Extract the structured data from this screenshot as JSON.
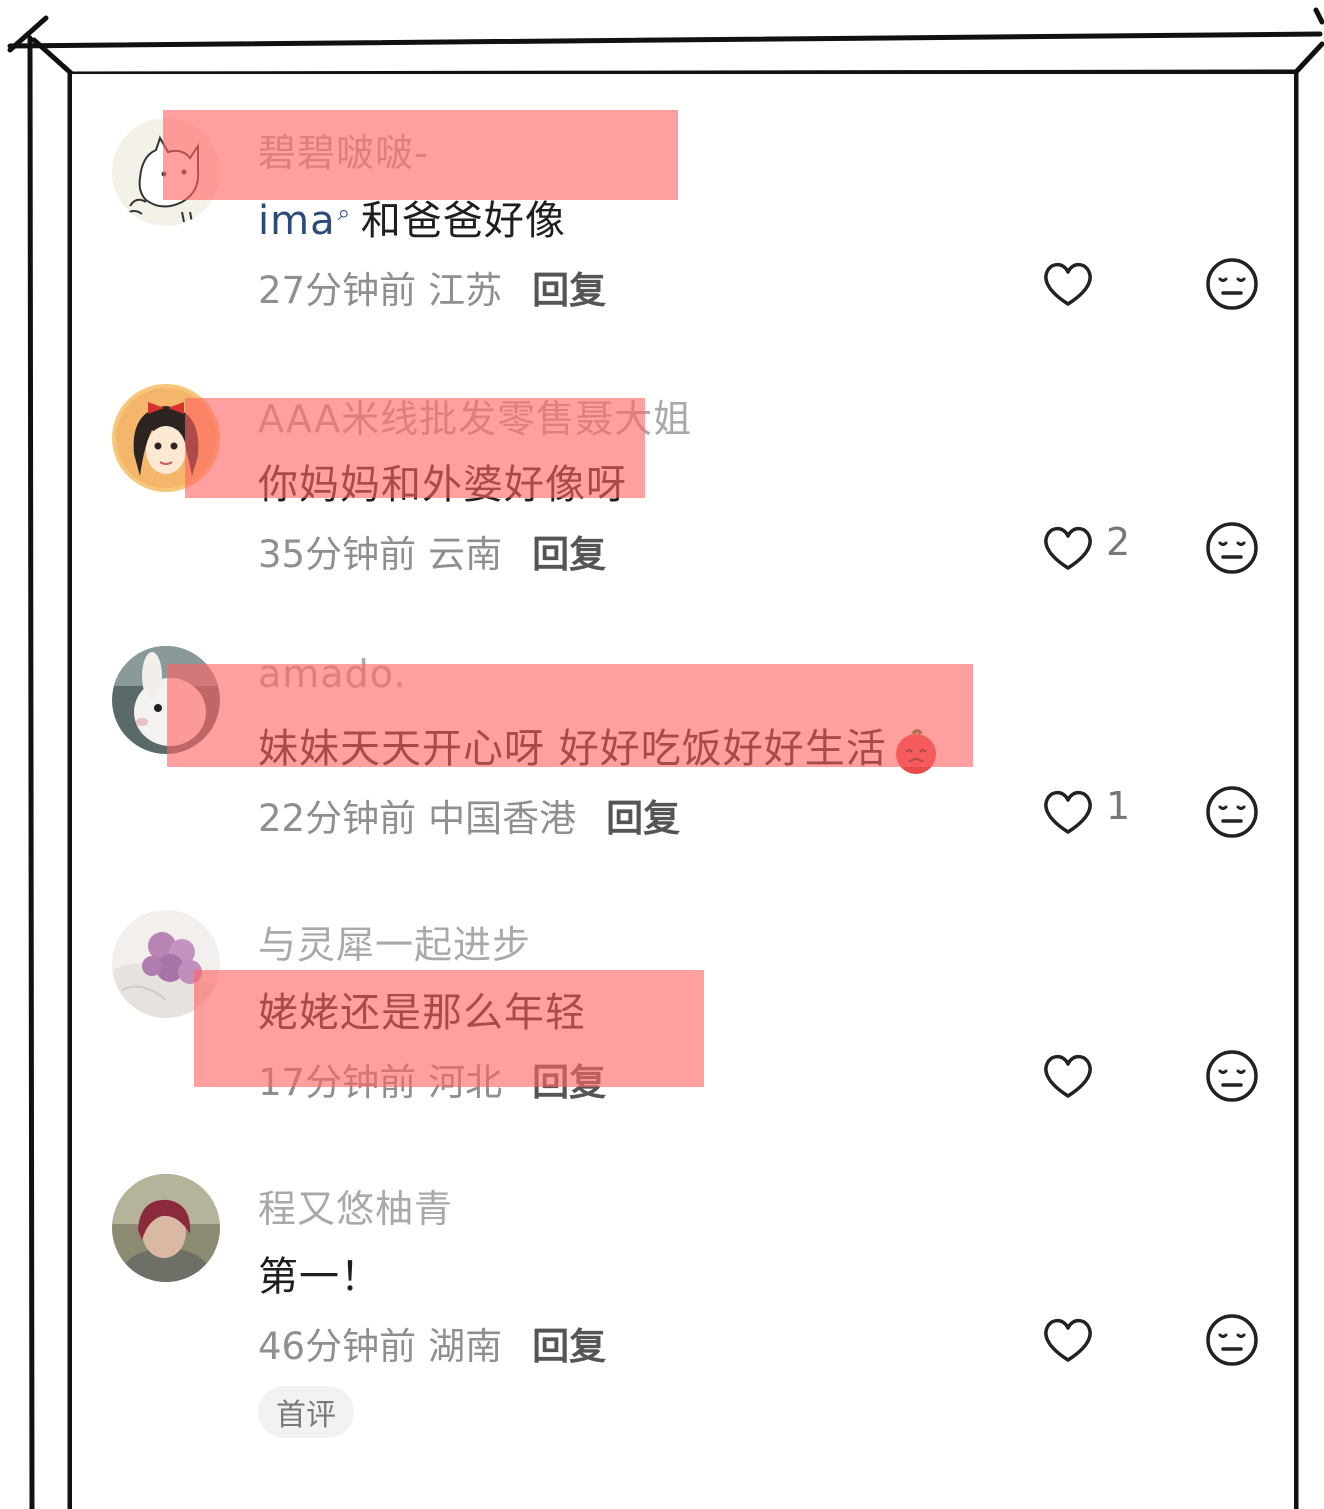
{
  "comments": [
    {
      "username": "碧碧啵啵-",
      "mention": "ima",
      "text": "和爸爸好像",
      "time": "27分钟前",
      "location": "江苏",
      "reply_label": "回复",
      "likes": "",
      "avatar": "cat-doodle-avatar"
    },
    {
      "username": "AAA米线批发零售聂大姐",
      "mention": "",
      "text": "你妈妈和外婆好像呀",
      "time": "35分钟前",
      "location": "云南",
      "reply_label": "回复",
      "likes": "2",
      "avatar": "anime-girl-avatar"
    },
    {
      "username": "amado.",
      "mention": "",
      "text": "妹妹天天开心呀 好好吃饭好好生活",
      "time": "22分钟前",
      "location": "中国香港",
      "reply_label": "回复",
      "likes": "1",
      "avatar": "rabbit-avatar"
    },
    {
      "username": "与灵犀一起进步",
      "mention": "",
      "text": "姥姥还是那么年轻",
      "time": "17分钟前",
      "location": "河北",
      "reply_label": "回复",
      "likes": "",
      "avatar": "roses-avatar"
    },
    {
      "username": "程又悠柚青",
      "mention": "",
      "text": "第一！",
      "time": "46分钟前",
      "location": "湖南",
      "reply_label": "回复",
      "likes": "",
      "avatar": "girl-photo-avatar"
    }
  ],
  "first_comment_badge": "首评",
  "colors": {
    "highlight": "#ff6464",
    "username": "#a9a9a9",
    "mention": "#2b4a7a"
  }
}
